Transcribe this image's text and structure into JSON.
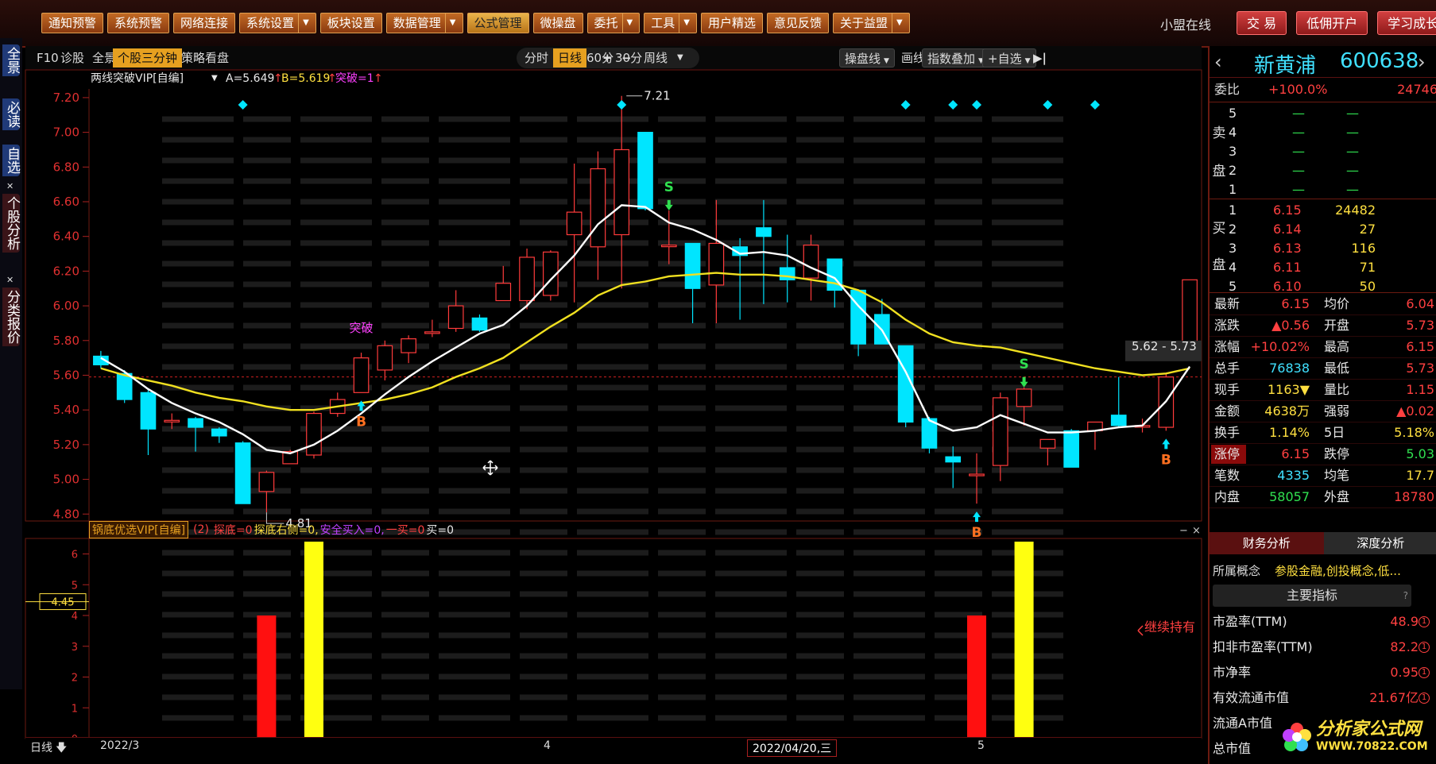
{
  "menu": [
    {
      "label": "通知预警",
      "dd": false,
      "active": false
    },
    {
      "label": "系统预警",
      "dd": false,
      "active": false
    },
    {
      "label": "网络连接",
      "dd": false,
      "active": false
    },
    {
      "label": "系统设置",
      "dd": true,
      "active": false
    },
    {
      "label": "板块设置",
      "dd": false,
      "active": false
    },
    {
      "label": "数据管理",
      "dd": true,
      "active": false
    },
    {
      "label": "公式管理",
      "dd": false,
      "active": true
    },
    {
      "label": "微操盘",
      "dd": false,
      "active": false
    },
    {
      "label": "委托",
      "dd": true,
      "active": false
    },
    {
      "label": "工具",
      "dd": true,
      "active": false
    },
    {
      "label": "用户精选",
      "dd": false,
      "active": false
    },
    {
      "label": "意见反馈",
      "dd": false,
      "active": false
    },
    {
      "label": "关于益盟",
      "dd": true,
      "active": false
    }
  ],
  "online": "小盟在线",
  "right_buttons": [
    "交 易",
    "低佣开户",
    "学习成长"
  ],
  "left_tabs": [
    "全景",
    "必读",
    "自选",
    "个股分析",
    "分类报价"
  ],
  "toolbar": {
    "left": [
      "F10",
      "诊股",
      "全景",
      "个股三分钟",
      "策略看盘"
    ],
    "periods": [
      "分时",
      "日线",
      "60分",
      "30分",
      "周线"
    ],
    "zoom": [
      "+",
      "−"
    ],
    "right": [
      "操盘线",
      "画线",
      "指数叠加",
      "+自选"
    ]
  },
  "main_indicator": {
    "name": "两线突破VIP[自编]",
    "a": "A=5.649",
    "b": "B=5.619",
    "c": "突破=1"
  },
  "price_axis": [
    "7.20",
    "7.00",
    "6.80",
    "6.60",
    "6.40",
    "6.20",
    "6.00",
    "5.80",
    "5.60",
    "5.40",
    "5.20",
    "5.00",
    "4.80"
  ],
  "annotations": {
    "high": "7.21",
    "low": "4.81",
    "range": "5.62 - 5.73",
    "breakout": "突破",
    "buy": "B",
    "sell": "S"
  },
  "bottom_indicator": {
    "name": "锅底优选VIP[自编]",
    "param": "(2)",
    "vals": [
      {
        "t": "探底=0",
        "c": "#ff4040"
      },
      {
        "t": "探底右侧=0,",
        "c": "#ffe040"
      },
      {
        "t": "安全买入=0,",
        "c": "#c040ff"
      },
      {
        "t": "一买=0",
        "c": "#ff4040"
      },
      {
        "t": "买=0",
        "c": "#e8e8e8"
      }
    ],
    "axis": [
      "6",
      "5",
      "4",
      "3",
      "2",
      "1",
      "0"
    ],
    "current": "4.45",
    "hold": "继续持有"
  },
  "xaxis": {
    "period": "日线",
    "labels": [
      "2022/3",
      "4",
      "2022/04/20,三",
      "5"
    ]
  },
  "chart_data": {
    "type": "candlestick",
    "ylim": [
      4.76,
      7.25
    ],
    "candles": [
      [
        5.71,
        5.66,
        5.74,
        5.64
      ],
      [
        5.61,
        5.46,
        5.63,
        5.44
      ],
      [
        5.5,
        5.29,
        5.52,
        5.14
      ],
      [
        5.34,
        5.34,
        5.38,
        5.29
      ],
      [
        5.35,
        5.3,
        5.36,
        5.16
      ],
      [
        5.29,
        5.25,
        5.3,
        5.21
      ],
      [
        5.21,
        4.86,
        5.22,
        4.86
      ],
      [
        4.93,
        5.04,
        5.05,
        4.81
      ],
      [
        5.09,
        5.16,
        5.17,
        5.09
      ],
      [
        5.14,
        5.38,
        5.39,
        5.12
      ],
      [
        5.38,
        5.46,
        5.5,
        5.36
      ],
      [
        5.5,
        5.7,
        5.73,
        5.5
      ],
      [
        5.63,
        5.77,
        5.8,
        5.57
      ],
      [
        5.73,
        5.81,
        5.83,
        5.67
      ],
      [
        5.85,
        5.85,
        5.92,
        5.82
      ],
      [
        5.87,
        6.0,
        6.09,
        5.85
      ],
      [
        5.93,
        5.86,
        5.95,
        5.85
      ],
      [
        6.03,
        6.13,
        6.23,
        6.04
      ],
      [
        6.03,
        6.28,
        6.33,
        5.98
      ],
      [
        6.06,
        6.31,
        6.32,
        6.03
      ],
      [
        6.41,
        6.54,
        6.82,
        6.02
      ],
      [
        6.34,
        6.79,
        6.89,
        6.15
      ],
      [
        6.41,
        6.9,
        7.21,
        6.1
      ],
      [
        7.0,
        6.56,
        7.0,
        6.55
      ],
      [
        6.35,
        6.35,
        6.55,
        6.24
      ],
      [
        6.36,
        6.1,
        6.36,
        5.9
      ],
      [
        6.12,
        6.36,
        6.61,
        5.9
      ],
      [
        6.34,
        6.29,
        6.39,
        5.92
      ],
      [
        6.45,
        6.4,
        6.61,
        6.01
      ],
      [
        6.22,
        6.15,
        6.41,
        6.02
      ],
      [
        6.16,
        6.35,
        6.41,
        6.03
      ],
      [
        6.27,
        6.09,
        6.27,
        5.99
      ],
      [
        6.09,
        5.78,
        6.09,
        5.71
      ],
      [
        5.95,
        5.78,
        6.04,
        5.78
      ],
      [
        5.77,
        5.33,
        5.76,
        5.3
      ],
      [
        5.35,
        5.18,
        5.36,
        5.15
      ],
      [
        5.13,
        5.1,
        5.19,
        4.95
      ],
      [
        5.03,
        5.03,
        5.15,
        4.86
      ],
      [
        5.08,
        5.47,
        5.5,
        4.99
      ],
      [
        5.42,
        5.52,
        5.53,
        5.31
      ],
      [
        5.18,
        5.23,
        5.23,
        5.08
      ],
      [
        5.28,
        5.07,
        5.29,
        5.07
      ],
      [
        5.28,
        5.33,
        5.33,
        5.17
      ],
      [
        5.37,
        5.31,
        5.59,
        5.3
      ],
      [
        5.31,
        5.31,
        5.35,
        5.27
      ],
      [
        5.3,
        5.59,
        5.61,
        5.28
      ],
      [
        5.73,
        6.15,
        6.15,
        5.73
      ]
    ],
    "ma_white": [
      5.7,
      5.62,
      5.52,
      5.44,
      5.38,
      5.33,
      5.26,
      5.17,
      5.15,
      5.2,
      5.28,
      5.38,
      5.49,
      5.59,
      5.68,
      5.76,
      5.84,
      5.89,
      6.0,
      6.15,
      6.29,
      6.47,
      6.58,
      6.57,
      6.48,
      6.44,
      6.38,
      6.3,
      6.31,
      6.29,
      6.22,
      6.16,
      6.0,
      5.86,
      5.62,
      5.34,
      5.28,
      5.3,
      5.37,
      5.32,
      5.27,
      5.27,
      5.28,
      5.3,
      5.31,
      5.45,
      5.65
    ],
    "ma_yellow": [
      5.64,
      5.6,
      5.57,
      5.54,
      5.5,
      5.47,
      5.45,
      5.42,
      5.4,
      5.4,
      5.42,
      5.44,
      5.46,
      5.49,
      5.53,
      5.59,
      5.64,
      5.7,
      5.79,
      5.88,
      5.96,
      6.06,
      6.12,
      6.14,
      6.17,
      6.18,
      6.19,
      6.18,
      6.18,
      6.17,
      6.15,
      6.13,
      6.09,
      6.02,
      5.92,
      5.84,
      5.79,
      5.77,
      5.76,
      5.73,
      5.7,
      5.67,
      5.64,
      5.62,
      5.6,
      5.61,
      5.64
    ],
    "bars": [
      {
        "index": 7,
        "value": 4,
        "color": "#ff1010"
      },
      {
        "index": 9,
        "value": 8,
        "color": "#ffff10"
      },
      {
        "index": 37,
        "value": 4,
        "color": "#ff1010"
      },
      {
        "index": 39,
        "value": 8,
        "color": "#ffff10"
      }
    ],
    "bar_ylim": [
      0,
      6.4
    ],
    "top_markers": [
      6,
      22,
      34,
      36,
      37,
      40,
      42
    ],
    "buy_signals": [
      11,
      37,
      45
    ],
    "sell_signals": [
      24,
      39
    ],
    "breakouts": [
      11,
      45
    ]
  },
  "stock": {
    "name": "新黄浦",
    "code": "600638"
  },
  "weibi": {
    "label": "委比",
    "pct": "+100.0%",
    "val": "24746"
  },
  "sell_levels": [
    {
      "n": "5",
      "p": "—",
      "v": "—"
    },
    {
      "n": "4",
      "p": "—",
      "v": "—"
    },
    {
      "n": "3",
      "p": "—",
      "v": "—"
    },
    {
      "n": "2",
      "p": "—",
      "v": "—"
    },
    {
      "n": "1",
      "p": "—",
      "v": "—"
    }
  ],
  "buy_levels": [
    {
      "n": "1",
      "p": "6.15",
      "v": "24482"
    },
    {
      "n": "2",
      "p": "6.14",
      "v": "27"
    },
    {
      "n": "3",
      "p": "6.13",
      "v": "116"
    },
    {
      "n": "4",
      "p": "6.11",
      "v": "71"
    },
    {
      "n": "5",
      "p": "6.10",
      "v": "50"
    }
  ],
  "side": {
    "sell1": "卖",
    "sell2": "盘",
    "buy1": "买",
    "buy2": "盘"
  },
  "quote": [
    {
      "l1": "最新",
      "v1": "6.15",
      "c1": "red",
      "l2": "均价",
      "v2": "6.04",
      "c2": "red"
    },
    {
      "l1": "涨跌",
      "v1": "▲0.56",
      "c1": "red",
      "l2": "开盘",
      "v2": "5.73",
      "c2": "red"
    },
    {
      "l1": "涨幅",
      "v1": "+10.02%",
      "c1": "red",
      "l2": "最高",
      "v2": "6.15",
      "c2": "red"
    },
    {
      "l1": "总手",
      "v1": "76838",
      "c1": "cyn",
      "l2": "最低",
      "v2": "5.73",
      "c2": "red"
    },
    {
      "l1": "现手",
      "v1": "1163▼",
      "c1": "yel",
      "l2": "量比",
      "v2": "1.15",
      "c2": "red"
    },
    {
      "l1": "金额",
      "v1": "4638万",
      "c1": "yel",
      "l2": "强弱",
      "v2": "▲0.02",
      "c2": "red"
    },
    {
      "l1": "换手",
      "v1": "1.14%",
      "c1": "yel",
      "l2": "5日",
      "v2": "5.18%",
      "c2": "yel"
    },
    {
      "l1": "涨停",
      "v1": "6.15",
      "c1": "red",
      "l2": "跌停",
      "v2": "5.03",
      "c2": "grn"
    },
    {
      "l1": "笔数",
      "v1": "4335",
      "c1": "cyn",
      "l2": "均笔",
      "v2": "17.7",
      "c2": "yel"
    },
    {
      "l1": "内盘",
      "v1": "58057",
      "c1": "grn",
      "l2": "外盘",
      "v2": "18780",
      "c2": "red"
    }
  ],
  "fin_tabs": [
    "财务分析",
    "深度分析"
  ],
  "concept": {
    "label": "所属概念",
    "val": "参股金融,创投概念,低..."
  },
  "main_title": "主要指标",
  "help_mark": "?",
  "fin": [
    {
      "l": "市盈率(TTM)",
      "v": "48.9"
    },
    {
      "l": "扣非市盈率(TTM)",
      "v": "82.2"
    },
    {
      "l": "市净率",
      "v": "0.95"
    },
    {
      "l": "有效流通市值",
      "v": "21.67亿"
    },
    {
      "l": "流通A市值",
      "v": ""
    },
    {
      "l": "总市值",
      "v": ""
    }
  ],
  "logo": {
    "text": "分析家公式网",
    "url": "WWW.70822.COM"
  }
}
